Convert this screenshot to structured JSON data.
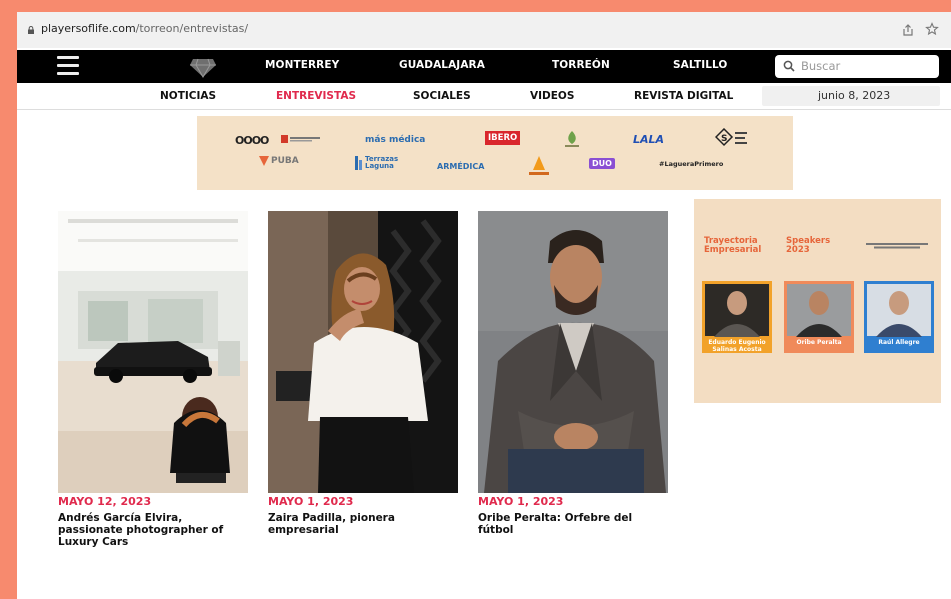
{
  "browser": {
    "url_domain": "playersoflife.com",
    "url_path": "/torreon/entrevistas/",
    "icons": [
      "lock-icon",
      "share-icon",
      "star-icon"
    ]
  },
  "city_nav": {
    "cities": [
      "MONTERREY",
      "GUADALAJARA",
      "TORREÓN",
      "SALTILLO"
    ],
    "search_placeholder": "Buscar",
    "icons": [
      "menu-icon",
      "diamond-logo-icon",
      "search-icon"
    ]
  },
  "sections_nav": {
    "items": [
      "NOTICIAS",
      "ENTREVISTAS",
      "SOCIALES",
      "VIDEOS",
      "REVISTA DIGITAL"
    ],
    "active": "ENTREVISTAS",
    "date": "junio 8, 2023"
  },
  "sponsors": {
    "logos": [
      "OOOO",
      "más médica",
      "IBERO",
      "LALA",
      "PUBA",
      "Terrazas Laguna",
      "ARMÉDICA",
      "DUO",
      "#LagueraPrimero"
    ]
  },
  "articles": [
    {
      "date": "MAYO 12, 2023",
      "title": "Andrés García Elvira, passionate photographer of Luxury Cars"
    },
    {
      "date": "MAYO 1, 2023",
      "title": "Zaira Padilla, pionera empresarial"
    },
    {
      "date": "MAYO 1, 2023",
      "title": "Oribe Peralta: Orfebre del fútbol"
    }
  ],
  "ad": {
    "heading_left": "Trayectoria Empresarial",
    "heading_right": "Speakers 2023",
    "speakers": [
      {
        "name": "Eduardo Eugenio Salinas Acosta"
      },
      {
        "name": "Oribe Peralta"
      },
      {
        "name": "Raúl Allegre"
      }
    ]
  },
  "colors": {
    "accent": "#e02a4d",
    "nav_bg": "#000000",
    "frame": "#f78a6e",
    "banner_bg": "#f4e1c7"
  }
}
